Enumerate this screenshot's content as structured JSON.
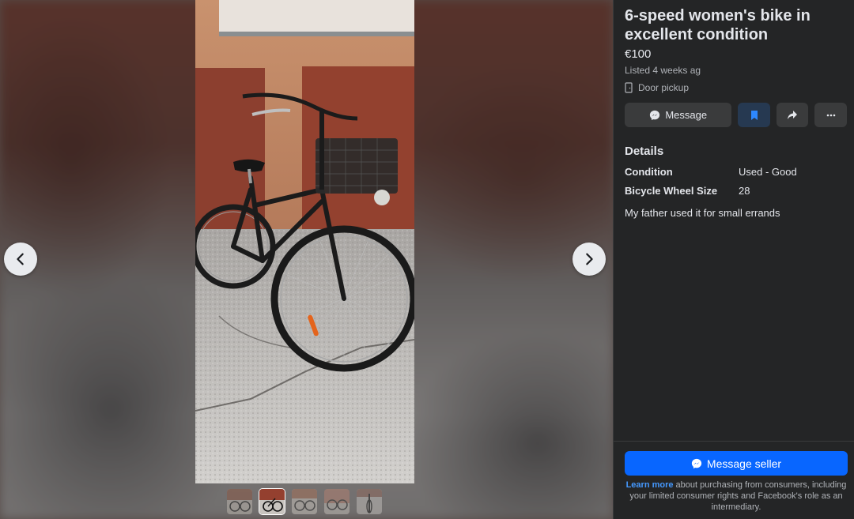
{
  "listing": {
    "title": "6-speed women's bike in excellent condition",
    "price": "€100",
    "listed": "Listed 4 weeks ag",
    "pickup": "Door pickup"
  },
  "actions": {
    "message_label": "Message",
    "save_icon": "bookmark-icon",
    "share_icon": "share-icon",
    "more_icon": "more-icon"
  },
  "details": {
    "heading": "Details",
    "rows": [
      {
        "key": "Condition",
        "value": "Used - Good"
      },
      {
        "key": "Bicycle Wheel Size",
        "value": "28"
      }
    ],
    "description": "My father used it for small errands"
  },
  "footer": {
    "message_seller_label": "Message seller",
    "learn_more": "Learn more",
    "disclaimer_rest": " about purchasing from consumers, including your limited consumer rights and Facebook's role as an intermediary."
  },
  "gallery": {
    "thumbnail_count": 5,
    "active_index": 1,
    "prev_icon": "chevron-left-icon",
    "next_icon": "chevron-right-icon"
  },
  "colors": {
    "accent": "#0866ff",
    "panel_bg": "#242526",
    "save_bg": "#263951"
  }
}
